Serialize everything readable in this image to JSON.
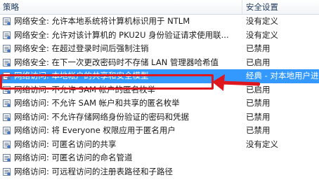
{
  "header": {
    "policy_label": "策略",
    "setting_label": "安全设置"
  },
  "rows": [
    {
      "name": "网络安全: 允许本地系统将计算机标识用于 NTLM",
      "value": "没有定义"
    },
    {
      "name": "网络安全: 允许对该计算机的 PKU2U 身份验证请求使用联...",
      "value": "没有定义"
    },
    {
      "name": "网络安全: 在超过登录时间后强制注销",
      "value": "已禁用"
    },
    {
      "name": "网络安全: 在下一次更改密码时不存储 LAN 管理器哈希值",
      "value": "已启用"
    },
    {
      "name": "网络访问: 本地帐户的共享和安全模型",
      "value": "经典 - 对本地用户进"
    },
    {
      "name": "网络访问: 不允许 SAM 帐户的匿名枚举",
      "value": "已启用"
    },
    {
      "name": "网络访问: 不允许 SAM 帐户和共享的匿名枚举",
      "value": "已禁用"
    },
    {
      "name": "网络访问: 不允许存储网络身份验证的密码和凭据",
      "value": "已禁用"
    },
    {
      "name": "网络访问: 将 Everyone 权限应用于匿名用户",
      "value": "已禁用"
    },
    {
      "name": "网络访问: 可匿名访问的共享",
      "value": "没有定义"
    },
    {
      "name": "网络访问: 可匿名访问的命名管道",
      "value": ""
    },
    {
      "name": "网络访问: 可远程访问的注册表路径和子路径",
      "value": ""
    }
  ],
  "selected_index": 4,
  "colors": {
    "selection": "#3399ff",
    "annotation": "#e0161e"
  },
  "icons": {
    "policy_row": "policy-document-icon",
    "annotation": "red-arrow-icon"
  }
}
